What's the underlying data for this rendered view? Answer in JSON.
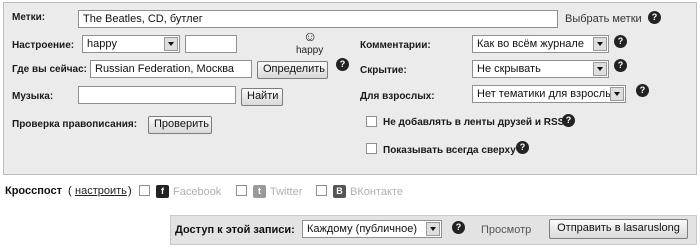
{
  "form": {
    "tags": {
      "label": "Метки:",
      "value": "The Beatles, CD, бутлег",
      "choose_link": "Выбрать метки"
    },
    "mood": {
      "label": "Настроение:",
      "selected": "happy",
      "custom_value": "",
      "icon_caption": "happy"
    },
    "location": {
      "label": "Где вы сейчас:",
      "value": "Russian Federation, Москва",
      "detect_button": "Определить"
    },
    "music": {
      "label": "Музыка:",
      "value": "",
      "find_button": "Найти"
    },
    "spellcheck": {
      "label": "Проверка правописания:",
      "check_button": "Проверить"
    },
    "comments": {
      "label": "Комментарии:",
      "selected": "Как во всём журнале"
    },
    "screening": {
      "label": "Скрытие:",
      "selected": "Не скрывать"
    },
    "adult": {
      "label": "Для взрослых:",
      "selected": "Нет тематики для взрослых"
    },
    "no_feeds": {
      "label": "Не добавлять в ленты друзей и RSS",
      "checked": false
    },
    "sticky": {
      "label": "Показывать всегда сверху",
      "checked": false
    }
  },
  "crosspost": {
    "label": "Кросспост",
    "open_paren": "(",
    "setup_link": "настроить",
    "close_paren": ")",
    "services": [
      {
        "name": "Facebook",
        "icon": "facebook-icon",
        "icon_glyph": "f",
        "color": "#222222"
      },
      {
        "name": "Twitter",
        "icon": "twitter-icon",
        "icon_glyph": "t",
        "color": "#9a9a9a"
      },
      {
        "name": "ВКонтакте",
        "icon": "vkontakte-icon",
        "icon_glyph": "В",
        "color": "#555555"
      }
    ]
  },
  "access": {
    "label": "Доступ к этой записи:",
    "selected": "Каждому (публичное)",
    "preview_link": "Просмотр",
    "submit_button": "Отправить в lasaruslong"
  },
  "icons": {
    "help_glyph": "?",
    "smiley_glyph": "☺"
  }
}
